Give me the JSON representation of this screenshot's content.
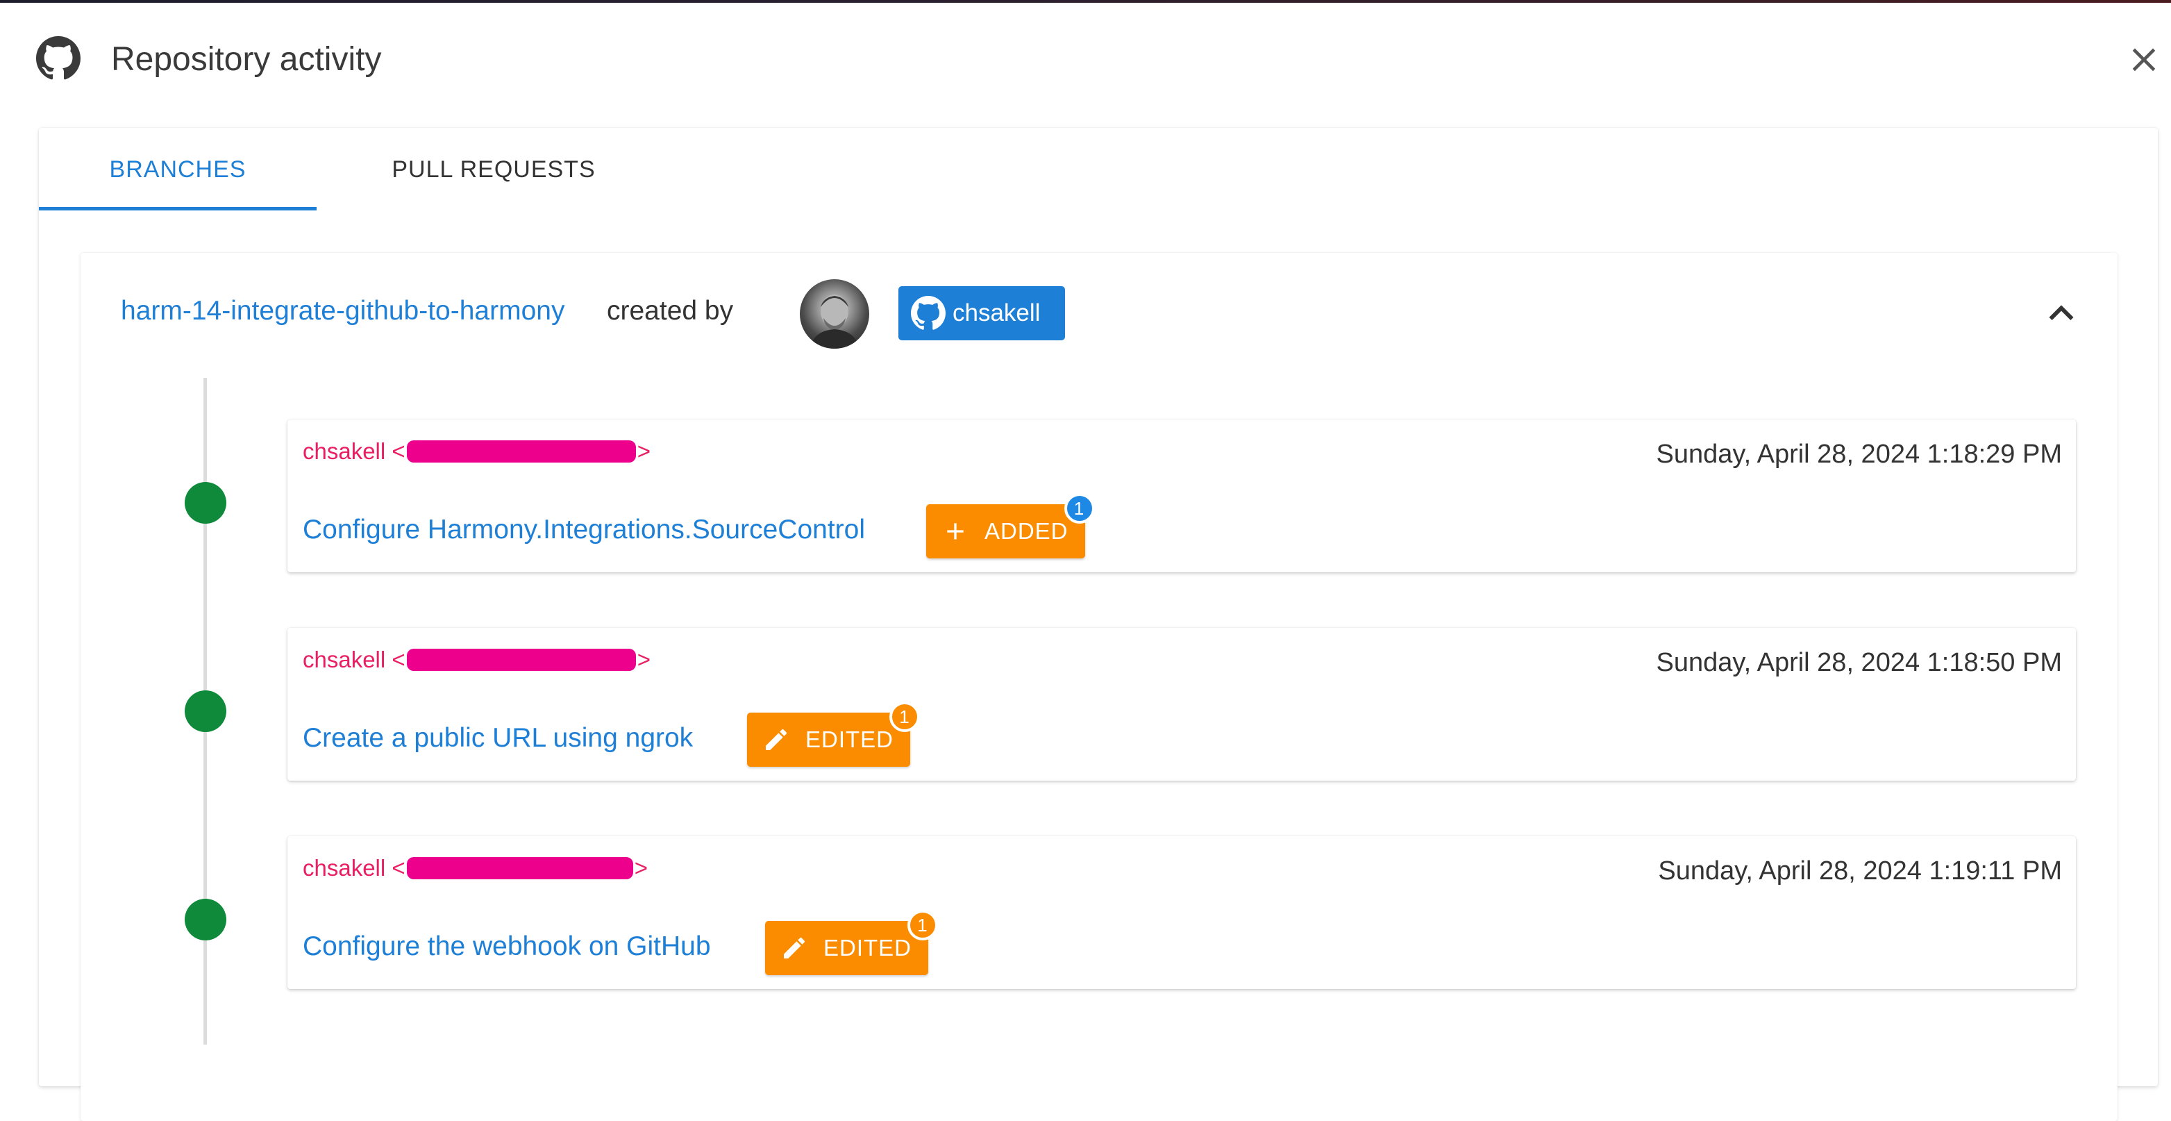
{
  "dialog": {
    "title": "Repository activity",
    "logo_icon": "github-icon",
    "close_icon": "close-icon"
  },
  "tabs": [
    {
      "label": "BRANCHES",
      "active": true
    },
    {
      "label": "PULL REQUESTS",
      "active": false
    }
  ],
  "branch": {
    "name": "harm-14-integrate-github-to-harmony",
    "created_by_label": "created by",
    "user_chip": "chsakell",
    "collapse_icon": "chevron-up-icon"
  },
  "commits": [
    {
      "author_name": "chsakell",
      "author_open": "<",
      "author_close": ">",
      "date": "Sunday, April 28, 2024 1:18:29 PM",
      "message": "Configure Harmony.Integrations.SourceControl",
      "badge_label": "ADDED",
      "badge_icon": "plus-icon",
      "badge_count": "1",
      "count_color": "#1e88e5"
    },
    {
      "author_name": "chsakell",
      "author_open": "<",
      "author_close": ">",
      "date": "Sunday, April 28, 2024 1:18:50 PM",
      "message": "Create a public URL using ngrok",
      "badge_label": "EDITED",
      "badge_icon": "pencil-icon",
      "badge_count": "1",
      "count_color": "#fb8c00"
    },
    {
      "author_name": "chsakell",
      "author_open": "<",
      "author_close": ">",
      "date": "Sunday, April 28, 2024 1:19:11 PM",
      "message": "Configure the webhook on GitHub",
      "badge_label": "EDITED",
      "badge_icon": "pencil-icon",
      "badge_count": "1",
      "count_color": "#fb8c00"
    }
  ],
  "colors": {
    "primary": "#1e7fd6",
    "author": "#e91e63",
    "badge": "#fb8c00",
    "timeline_dot": "#0e8a3a"
  }
}
